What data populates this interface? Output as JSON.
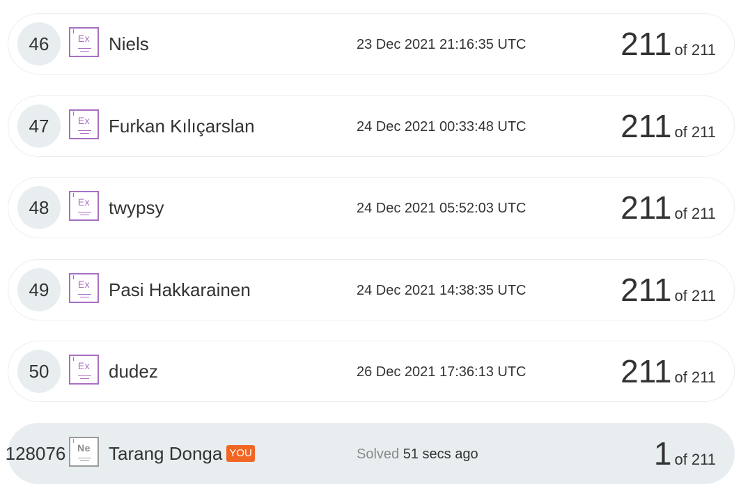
{
  "rows": [
    {
      "rank": "46",
      "level_symbol": "Ex",
      "name": "Niels",
      "date": "23 Dec 2021 21:16:35 UTC",
      "score": "211",
      "of_total": "of 211"
    },
    {
      "rank": "47",
      "level_symbol": "Ex",
      "name": "Furkan Kılıçarslan",
      "date": "24 Dec 2021 00:33:48 UTC",
      "score": "211",
      "of_total": "of 211"
    },
    {
      "rank": "48",
      "level_symbol": "Ex",
      "name": "twypsy",
      "date": "24 Dec 2021 05:52:03 UTC",
      "score": "211",
      "of_total": "of 211"
    },
    {
      "rank": "49",
      "level_symbol": "Ex",
      "name": "Pasi Hakkarainen",
      "date": "24 Dec 2021 14:38:35 UTC",
      "score": "211",
      "of_total": "of 211"
    },
    {
      "rank": "50",
      "level_symbol": "Ex",
      "name": "dudez",
      "date": "26 Dec 2021 17:36:13 UTC",
      "score": "211",
      "of_total": "of 211"
    }
  ],
  "current_user": {
    "rank": "128076",
    "level_symbol": "Ne",
    "name": "Tarang Donga",
    "badge": "YOU",
    "date_label": "Solved",
    "date_value": "51 secs ago",
    "score": "1",
    "of_total": "of 211"
  },
  "colors": {
    "level_expert": "#a86fc3",
    "level_newbie": "#9a9a9a",
    "you_badge": "#f26522",
    "highlight_row": "#e8edf0"
  }
}
